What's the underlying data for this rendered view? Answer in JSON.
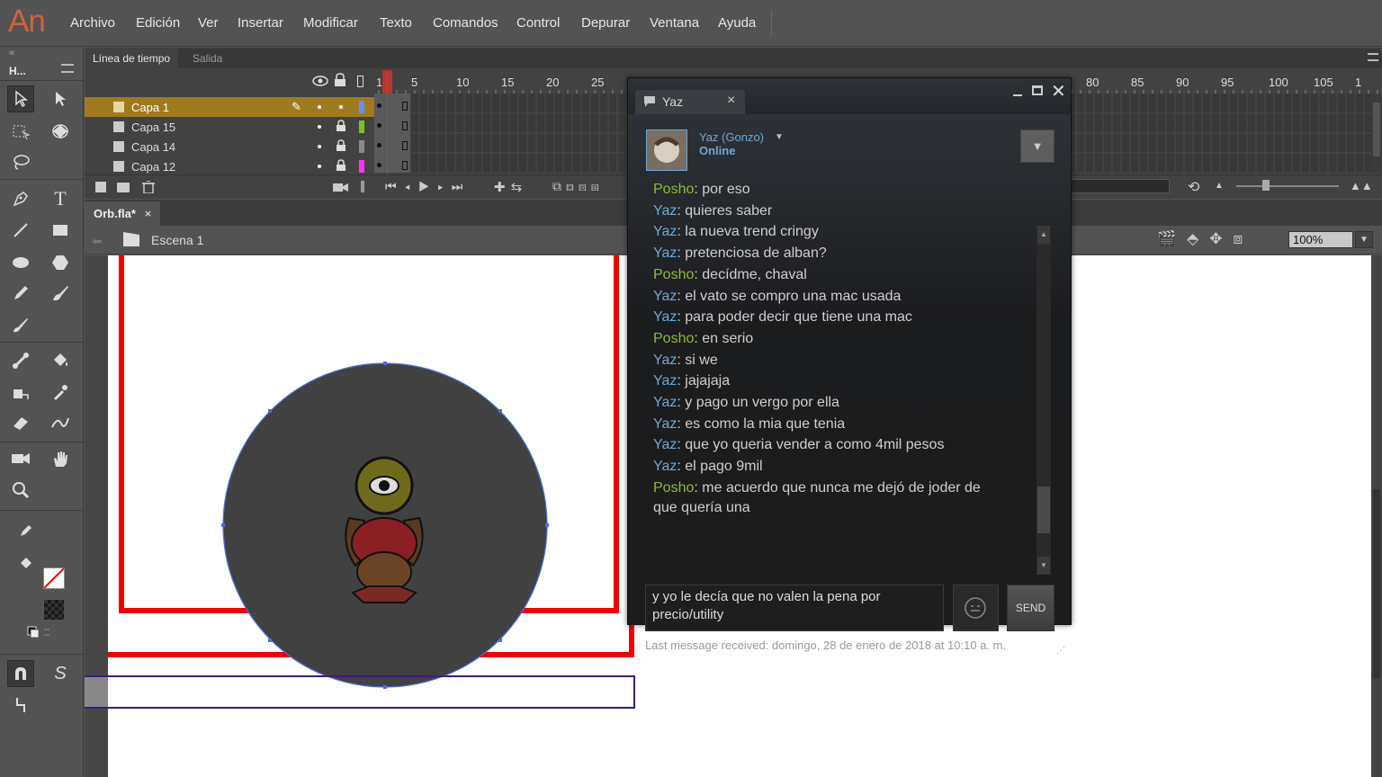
{
  "app": {
    "logo": "An"
  },
  "menu": [
    "Archivo",
    "Edición",
    "Ver",
    "Insertar",
    "Modificar",
    "Texto",
    "Comandos",
    "Control",
    "Depurar",
    "Ventana",
    "Ayuda"
  ],
  "tools_header": "H...",
  "timeline": {
    "tabs": [
      "Línea de tiempo",
      "Salida"
    ],
    "ruler": [
      "1",
      "5",
      "10",
      "15",
      "20",
      "25",
      "80",
      "85",
      "90",
      "95",
      "100",
      "105",
      "1"
    ],
    "layers": [
      {
        "name": "Capa 1",
        "color": "#6a8cff",
        "active": true
      },
      {
        "name": "Capa 15",
        "color": "#7ec217",
        "active": false
      },
      {
        "name": "Capa 14",
        "color": "#8a8a8a",
        "active": false
      },
      {
        "name": "Capa 12",
        "color": "#ff33ff",
        "active": false
      }
    ]
  },
  "document": {
    "tab": "Orb.fla*",
    "close": "×",
    "scene": "Escena 1",
    "zoom": "100%"
  },
  "chat": {
    "window_tab": "Yaz",
    "tab_close": "×",
    "contact_name": "Yaz (Gonzo)",
    "contact_status": "Online",
    "messages": [
      {
        "sender": "Posho",
        "text": "por eso"
      },
      {
        "sender": "Yaz",
        "text": "quieres saber"
      },
      {
        "sender": "Yaz",
        "text": "la nueva trend cringy"
      },
      {
        "sender": "Yaz",
        "text": "pretenciosa de alban?"
      },
      {
        "sender": "Posho",
        "text": "decídme, chaval"
      },
      {
        "sender": "Yaz",
        "text": "el vato se compro una mac usada"
      },
      {
        "sender": "Yaz",
        "text": "para poder decir que tiene una mac"
      },
      {
        "sender": "Posho",
        "text": "en serio"
      },
      {
        "sender": "Yaz",
        "text": "si we"
      },
      {
        "sender": "Yaz",
        "text": "jajajaja"
      },
      {
        "sender": "Yaz",
        "text": "y pago un vergo por ella"
      },
      {
        "sender": "Yaz",
        "text": "es como la mia que tenia"
      },
      {
        "sender": "Yaz",
        "text": "que yo queria vender a como 4mil pesos"
      },
      {
        "sender": "Yaz",
        "text": "el pago 9mil"
      },
      {
        "sender": "Posho",
        "text": "me acuerdo que nunca me dejó de joder de"
      }
    ],
    "wrap_line": "que quería una",
    "input_value": "y yo le decía que no valen la pena por precio/utility",
    "send_label": "SEND",
    "last_message": "Last message received: domingo, 28 de enero de 2018 at 10:10 a. m.",
    "colors": {
      "yaz": "#6fa9d6",
      "posho": "#8fb93a"
    }
  }
}
